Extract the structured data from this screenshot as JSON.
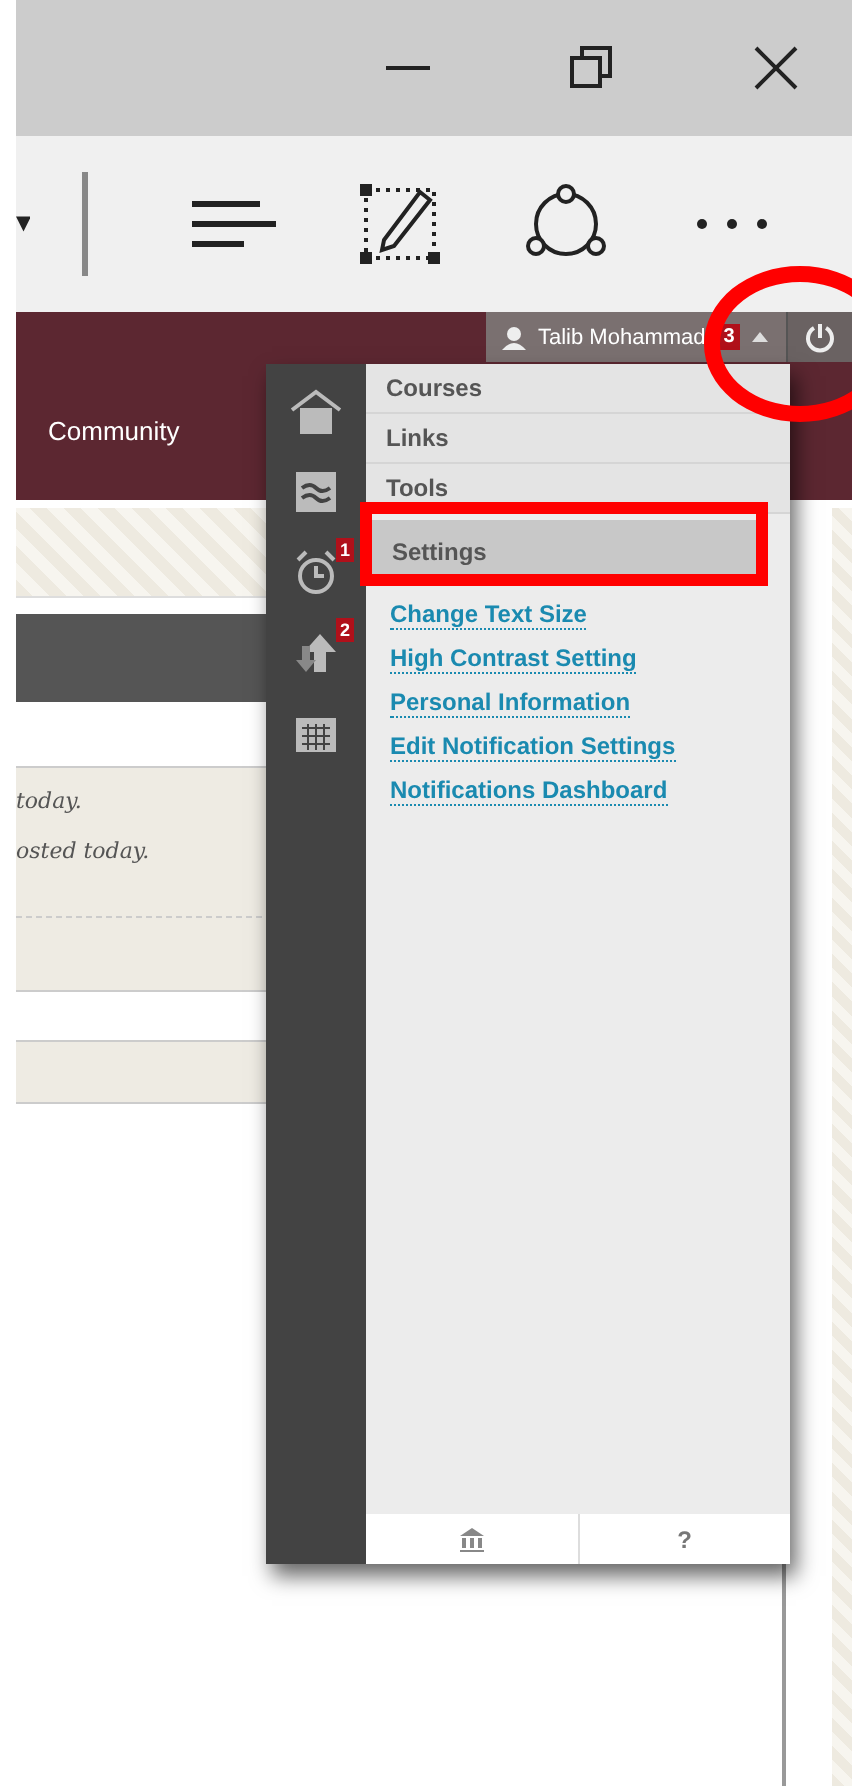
{
  "window": {
    "controls": [
      {
        "kind": "minimize"
      },
      {
        "kind": "restore"
      },
      {
        "kind": "close"
      }
    ]
  },
  "browser_toolbar": {
    "tools": [
      {
        "kind": "hub"
      },
      {
        "kind": "note"
      },
      {
        "kind": "share"
      },
      {
        "kind": "more"
      }
    ]
  },
  "header": {
    "user": {
      "name": "Talib Mohammad",
      "badge": "3"
    },
    "nav": [
      "Community"
    ]
  },
  "page": {
    "messages": [
      "today.",
      "osted today."
    ]
  },
  "menu": {
    "rail": [
      {
        "kind": "home"
      },
      {
        "kind": "stream"
      },
      {
        "kind": "alarm",
        "badge": "1"
      },
      {
        "kind": "grades",
        "badge": "2"
      },
      {
        "kind": "calendar"
      }
    ],
    "sections": [
      {
        "label": "Courses",
        "selected": false
      },
      {
        "label": "Links",
        "selected": false
      },
      {
        "label": "Tools",
        "selected": false
      },
      {
        "label": "Settings",
        "selected": true
      }
    ],
    "links": [
      "Change Text Size",
      "High Contrast Setting",
      "Personal Information",
      "Edit Notification Settings",
      "Notifications Dashboard"
    ],
    "footer": {
      "help": "?"
    }
  }
}
